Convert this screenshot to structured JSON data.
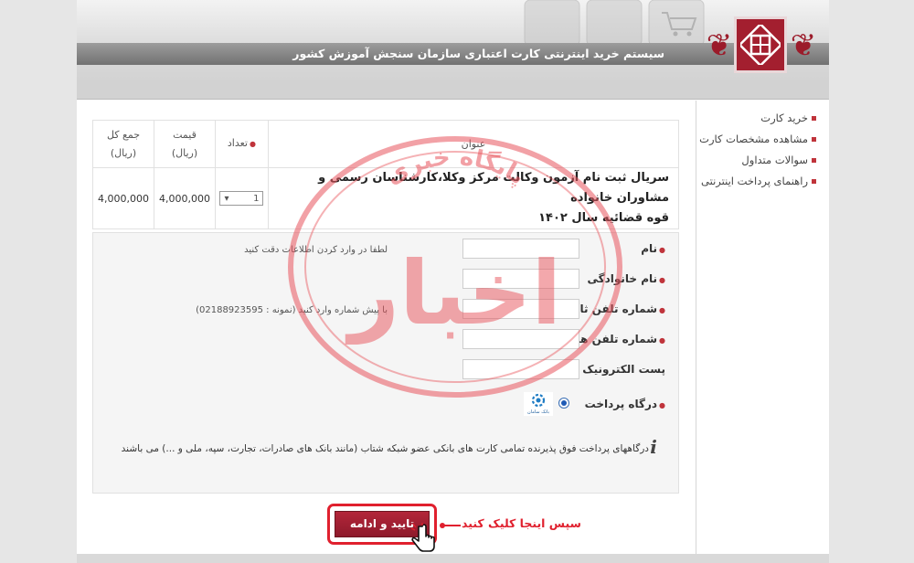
{
  "header": {
    "title": "سیستم خرید اینترنتی کارت اعتباری سازمان سنجش آموزش کشور"
  },
  "sidebar": {
    "items": [
      {
        "label": "خرید کارت"
      },
      {
        "label": "مشاهده مشخصات کارت"
      },
      {
        "label": "سوالات متداول"
      },
      {
        "label": "راهنمای پرداخت اینترنتی"
      }
    ]
  },
  "cart": {
    "headers": {
      "title": "عنوان",
      "quantity": "تعداد",
      "price": "قیمت",
      "price_unit": "(ریال)",
      "total": "جمع کل",
      "total_unit": "(ریال)"
    },
    "row": {
      "title_line1": "سریال ثبت نام آزمون وکالت مرکز وکلا،کارشناسان رسمی و مشاوران خانواده",
      "title_line2": "قوه قضائیه سال ۱۴۰۲",
      "quantity": "1",
      "price": "4,000,000",
      "total": "4,000,000"
    }
  },
  "form": {
    "name_label": "نام",
    "name_hint": "لطفا در وارد کردن اطلاعات دقت کنید",
    "family_label": "نام خانوادگی",
    "phone_label": "شماره تلفن ثابت",
    "phone_hint": "با پیش شماره وارد کنید (نمونه : 02188923595)",
    "mobile_label": "شماره تلفن همراه",
    "email_label": "پست الکترونیک",
    "gateway_label": "درگاه پرداخت",
    "bank_logo_text": "بانک سامان",
    "notice": "درگاههای پرداخت فوق پذیرنده تمامی کارت های بانکی عضو شبکه شتاب (مانند بانک های صادرات، تجارت، سپه، ملی و ...) می باشند"
  },
  "submit": {
    "label": "تایید و ادامه",
    "callout": "سپس اینجا کلیک کنید"
  },
  "watermark": {
    "top_text": "پایگاه خبری",
    "main_text": "اخبار"
  },
  "colors": {
    "accent": "#9b1b2a",
    "callout": "#e0202e",
    "watermark": "#e8545c",
    "title_bar": "#7d7d7d"
  }
}
